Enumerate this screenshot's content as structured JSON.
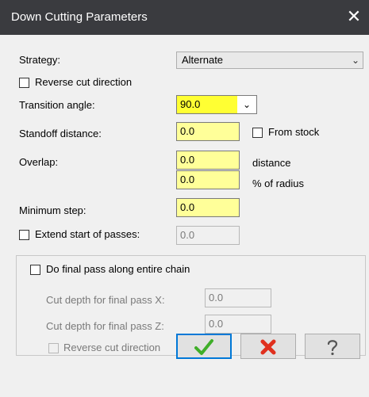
{
  "dialog": {
    "title": "Down Cutting Parameters",
    "close_glyph": "✕"
  },
  "strategy": {
    "label": "Strategy:",
    "value": "Alternate"
  },
  "reverse_cut": {
    "label": "Reverse cut direction",
    "checked": false
  },
  "transition_angle": {
    "label": "Transition angle:",
    "value": "90.0"
  },
  "standoff_distance": {
    "label": "Standoff distance:",
    "value": "0.0"
  },
  "from_stock": {
    "label": "From stock",
    "checked": false
  },
  "overlap": {
    "label": "Overlap:",
    "distance_value": "0.0",
    "distance_label": "distance",
    "radius_value": "0.0",
    "radius_label": "% of radius"
  },
  "minimum_step": {
    "label": "Minimum step:",
    "value": "0.0"
  },
  "extend_start": {
    "label": "Extend start of passes:",
    "value": "0.0",
    "checked": false
  },
  "final_pass": {
    "label": "Do final pass along entire chain",
    "checked": false,
    "depth_x_label": "Cut depth for final pass X:",
    "depth_x_value": "0.0",
    "depth_z_label": "Cut depth for final pass Z:",
    "depth_z_value": "0.0",
    "reverse_label": "Reverse cut direction"
  },
  "buttons": {
    "ok_icon": "check-icon",
    "cancel_icon": "cross-icon",
    "help_icon": "question-icon"
  },
  "colors": {
    "title_bar": "#3a3b3f",
    "required_field": "#ffff99",
    "active_field": "#ffff33",
    "ok_green": "#3fae29",
    "cancel_red": "#e0301e"
  }
}
